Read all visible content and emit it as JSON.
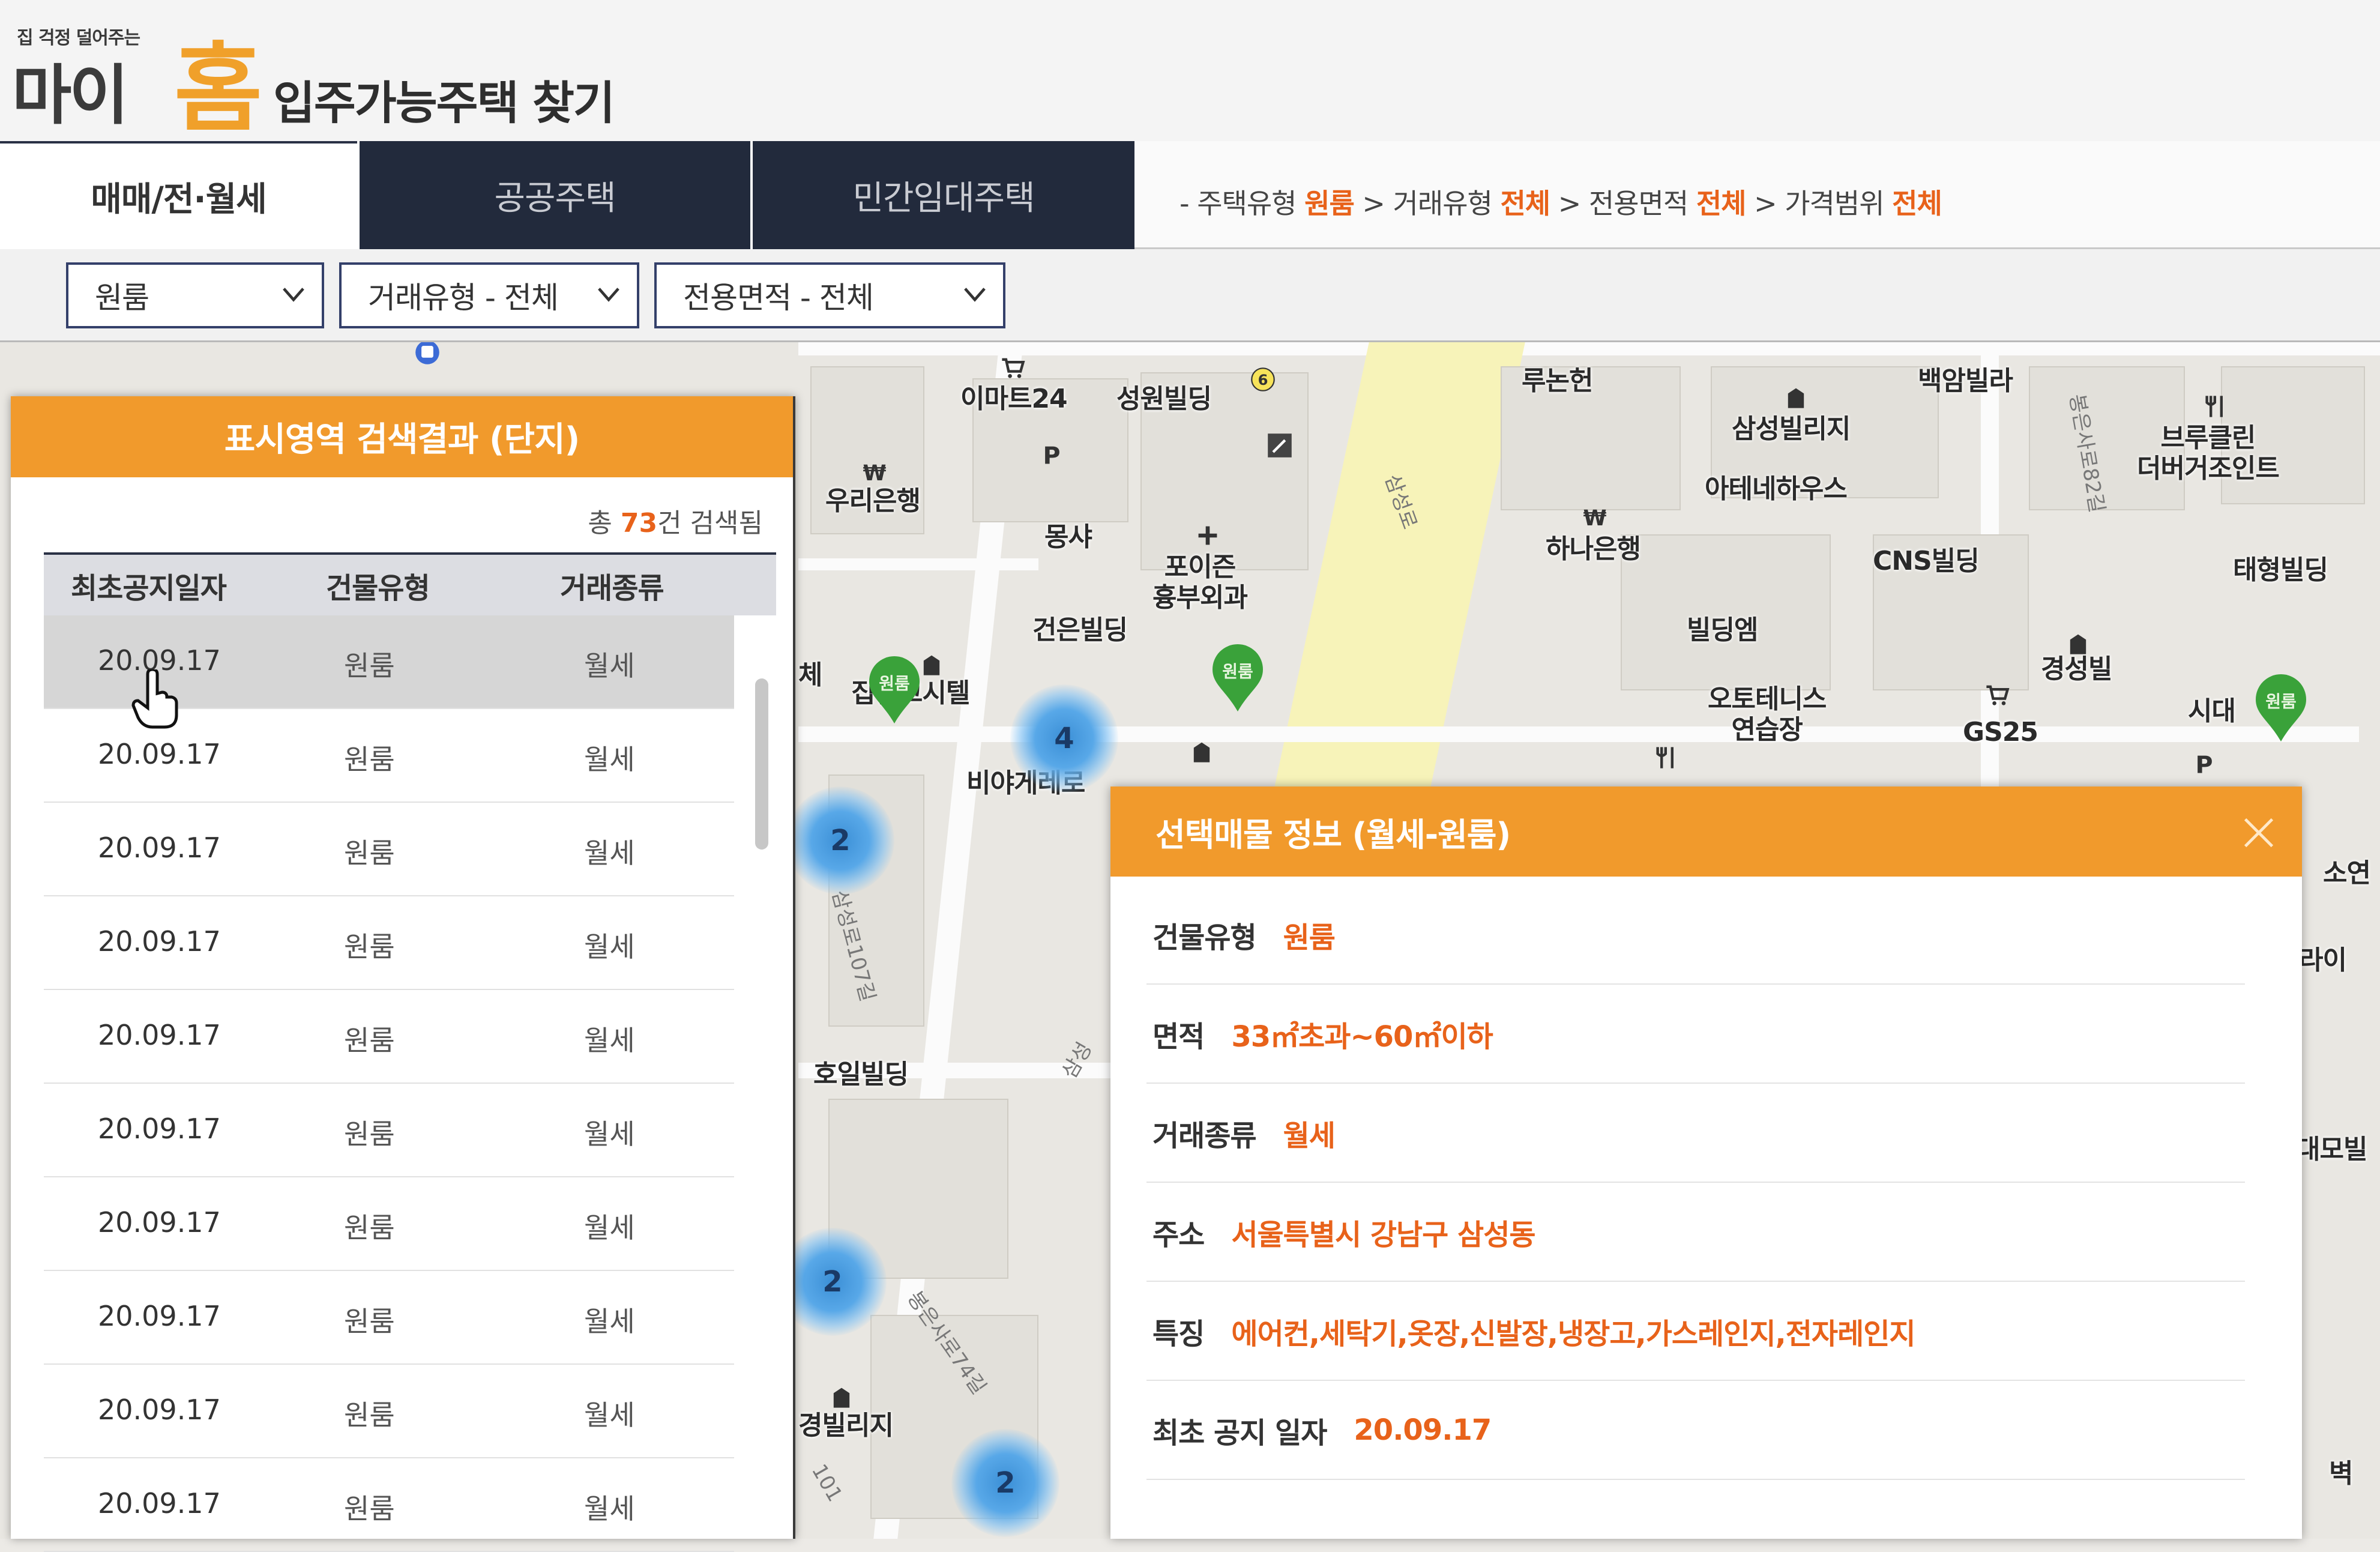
{
  "header": {
    "logo_slogan": "집 걱정 덜어주는",
    "logo_main": "마이",
    "logo_accent": "홈",
    "title": "입주가능주택 찾기"
  },
  "tabs": [
    {
      "label": "매매/전·월세"
    },
    {
      "label": "공공주택"
    },
    {
      "label": "민간임대주택"
    }
  ],
  "breadcrumb": {
    "p1": "- 주택유형 ",
    "v1": "원룸",
    "p2": " > 거래유형 ",
    "v2": "전체",
    "p3": " > 전용면적 ",
    "v3": "전체",
    "p4": " > 가격범위 ",
    "v4": "전체"
  },
  "filters": {
    "type": "원룸",
    "deal": "거래유형 - 전체",
    "area": "전용면적 - 전체"
  },
  "map": {
    "labels": {
      "emart": "이마트24",
      "seongwon": "성원빌딩",
      "woori": "우리은행",
      "mosha": "몽샤",
      "poijeun": "포이즌\n흉부외과",
      "geoneun": "건은빌딩",
      "jipmoks": "집밑고시텔",
      "biya": "비야게레로",
      "ruthnon": "루논헌",
      "samseong_village": "삼성빌리지",
      "athene": "아테네하우스",
      "hana": "하나은행",
      "baekam": "백암빌라",
      "bruklin": "브루클린\n더버거조인트",
      "cns": "CNS빌딩",
      "taehyung": "태형빌딩",
      "building_m": "빌딩엠",
      "gyeongseong": "경성빌",
      "otennis": "오토테니스\n연습장",
      "gs25": "GS25",
      "sidae": "시대",
      "hoil": "호일빌딩",
      "gyeong_village": "경빌리지",
      "soyeon": "소연",
      "raio": "라이",
      "daemo": "대모빌",
      "byeok": "벽",
      "che": "체"
    },
    "road_labels": {
      "samseongro": "삼성로",
      "samseongro107": "삼성로107길",
      "bongeunsaro74": "봉은사로74길",
      "bongeunsaro82": "봉은사로82길",
      "samseong2": "삼성",
      "num101": "101"
    },
    "clusters": [
      {
        "count": "4"
      },
      {
        "count": "2"
      },
      {
        "count": "2"
      },
      {
        "count": "2"
      }
    ],
    "pins": [
      {
        "label": "원룸"
      },
      {
        "label": "원룸"
      },
      {
        "label": "원룸"
      }
    ]
  },
  "results": {
    "title": "표시영역 검색결과 (단지)",
    "count_prefix": "총 ",
    "count": "73",
    "count_suffix": "건 검색됨",
    "columns": [
      "최초공지일자",
      "건물유형",
      "거래종류"
    ],
    "rows": [
      {
        "date": "20.09.17",
        "type": "원룸",
        "deal": "월세"
      },
      {
        "date": "20.09.17",
        "type": "원룸",
        "deal": "월세"
      },
      {
        "date": "20.09.17",
        "type": "원룸",
        "deal": "월세"
      },
      {
        "date": "20.09.17",
        "type": "원룸",
        "deal": "월세"
      },
      {
        "date": "20.09.17",
        "type": "원룸",
        "deal": "월세"
      },
      {
        "date": "20.09.17",
        "type": "원룸",
        "deal": "월세"
      },
      {
        "date": "20.09.17",
        "type": "원룸",
        "deal": "월세"
      },
      {
        "date": "20.09.17",
        "type": "원룸",
        "deal": "월세"
      },
      {
        "date": "20.09.17",
        "type": "원룸",
        "deal": "월세"
      },
      {
        "date": "20.09.17",
        "type": "원룸",
        "deal": "월세"
      }
    ]
  },
  "details": {
    "title": "선택매물 정보 (월세-원룸)",
    "fields": [
      {
        "label": "건물유형",
        "value": "원룸"
      },
      {
        "label": "면적",
        "value": "33㎡초과~60㎡이하"
      },
      {
        "label": "거래종류",
        "value": "월세"
      },
      {
        "label": "주소",
        "value": "서울특별시 강남구 삼성동"
      },
      {
        "label": "특징",
        "value": "에어컨,세탁기,옷장,신발장,냉장고,가스레인지,전자레인지"
      },
      {
        "label": "최초 공지 일자",
        "value": "20.09.17"
      }
    ]
  },
  "colors": {
    "accent_orange": "#f19a2c",
    "highlight_text": "#e8621a",
    "tab_dark": "#222a3c",
    "cluster_blue": "#3b8fd6",
    "pin_green": "#3aa23a"
  }
}
